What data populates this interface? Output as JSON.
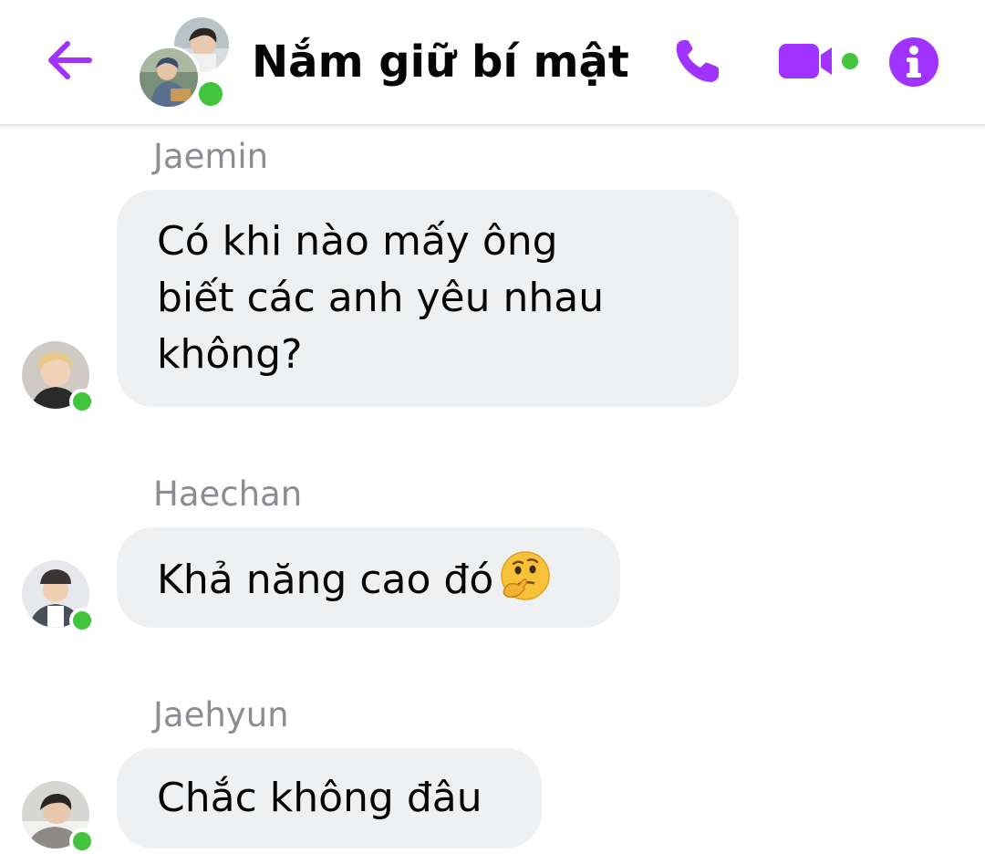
{
  "header": {
    "title": "Nắm giữ bí mật",
    "accent_color": "#a033ff",
    "online_color": "#42c43c",
    "icons": {
      "back": "arrow-left-icon",
      "call": "phone-icon",
      "video": "video-camera-icon",
      "info": "info-icon"
    }
  },
  "messages": [
    {
      "sender": "Jaemin",
      "lines": [
        "Có khi nào mấy ông",
        "biết các anh yêu nhau",
        "không?"
      ],
      "online": true
    },
    {
      "sender": "Haechan",
      "text": "Khả năng cao đó",
      "emoji": "thinking-face-emoji",
      "online": true
    },
    {
      "sender": "Jaehyun",
      "text": "Chắc không đâu",
      "online": true
    }
  ],
  "colors": {
    "bubble_bg": "#eff0f1",
    "sender_name": "#8a8d91",
    "text": "#050505"
  }
}
